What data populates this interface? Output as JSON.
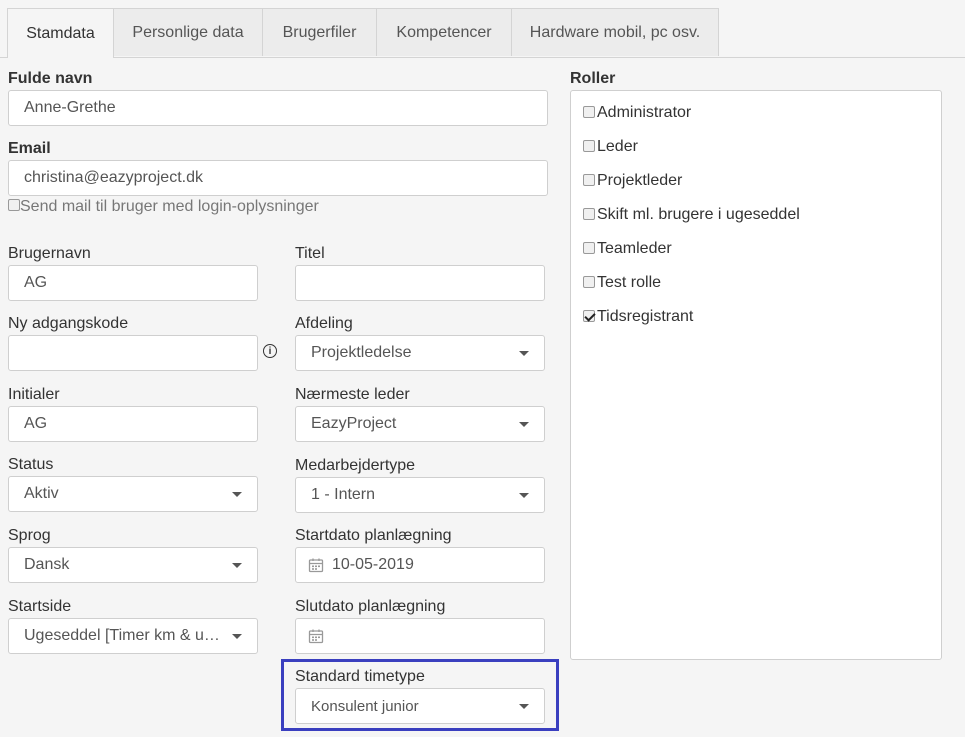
{
  "tabs": [
    {
      "label": "Stamdata",
      "active": true
    },
    {
      "label": "Personlige data",
      "active": false
    },
    {
      "label": "Brugerfiler",
      "active": false
    },
    {
      "label": "Kompetencer",
      "active": false
    },
    {
      "label": "Hardware mobil, pc osv.",
      "active": false
    }
  ],
  "form": {
    "fullname": {
      "label": "Fulde navn",
      "value": "Anne-Grethe"
    },
    "email": {
      "label": "Email",
      "value": "christina@eazyproject.dk"
    },
    "send_mail": {
      "label": "Send mail til bruger med login-oplysninger",
      "checked": false
    },
    "username": {
      "label": "Brugernavn",
      "value": "AG"
    },
    "title": {
      "label": "Titel",
      "value": ""
    },
    "password": {
      "label": "Ny adgangskode",
      "value": ""
    },
    "department": {
      "label": "Afdeling",
      "value": "Projektledelse"
    },
    "initials": {
      "label": "Initialer",
      "value": "AG"
    },
    "manager": {
      "label": "Nærmeste leder",
      "value": "EazyProject"
    },
    "status": {
      "label": "Status",
      "value": "Aktiv"
    },
    "employee_type": {
      "label": "Medarbejdertype",
      "value": "1 - Intern"
    },
    "language": {
      "label": "Sprog",
      "value": "Dansk"
    },
    "start_planning": {
      "label": "Startdato planlægning",
      "value": "10-05-2019"
    },
    "startpage": {
      "label": "Startside",
      "value": "Ugeseddel [Timer km & udlæg]"
    },
    "end_planning": {
      "label": "Slutdato planlægning",
      "value": ""
    },
    "time_type": {
      "label": "Standard timetype",
      "value": "Konsulent junior"
    }
  },
  "roles": {
    "label": "Roller",
    "items": [
      {
        "label": "Administrator",
        "checked": false
      },
      {
        "label": "Leder",
        "checked": false
      },
      {
        "label": "Projektleder",
        "checked": false
      },
      {
        "label": "Skift ml. brugere i ugeseddel",
        "checked": false
      },
      {
        "label": "Teamleder",
        "checked": false
      },
      {
        "label": "Test rolle",
        "checked": false
      },
      {
        "label": "Tidsregistrant",
        "checked": true
      }
    ]
  },
  "icons": {
    "info": "info-icon",
    "calendar": "calendar-icon",
    "dropdown": "chevron-down-icon"
  },
  "colors": {
    "highlight": "#3a3fbf"
  }
}
